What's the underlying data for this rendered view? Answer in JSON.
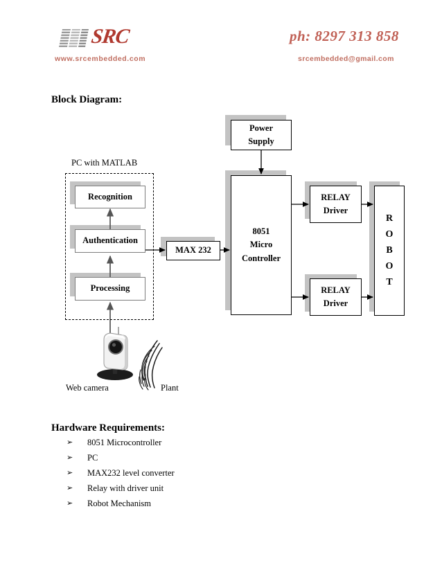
{
  "header": {
    "logo_text": "SRC",
    "phone": "ph: 8297 313 858",
    "website": "www.srcembedded.com",
    "email": "srcembedded@gmail.com",
    "accent_color": "#c06e60",
    "logo_color": "#b0392f"
  },
  "sections": {
    "block_diagram_heading": "Block Diagram:",
    "hardware_heading": "Hardware Requirements:"
  },
  "diagram": {
    "pc_label": "PC with MATLAB",
    "blocks": {
      "recognition": "Recognition",
      "authentication": "Authentication",
      "processing": "Processing",
      "max232": "MAX 232",
      "power_supply_line1": "Power",
      "power_supply_line2": "Supply",
      "mcu_line1": "8051",
      "mcu_line2": "Micro",
      "mcu_line3": "Controller",
      "relay_driver_top_line1": "RELAY",
      "relay_driver_top_line2": "Driver",
      "relay_driver_bottom_line1": "RELAY",
      "relay_driver_bottom_line2": "Driver",
      "robot_letters": [
        "R",
        "O",
        "B",
        "O",
        "T"
      ]
    },
    "image_labels": {
      "webcam": "Web camera",
      "plant": "Plant"
    },
    "colors": {
      "box_border": "#000000",
      "inner_box_border": "#7d7d7d",
      "shadow": "#c3c3c3",
      "arrow": "#000000"
    }
  },
  "hardware_requirements": {
    "bullet_glyph": "➢",
    "items": [
      "8051 Microcontroller",
      "PC",
      "MAX232 level converter",
      "Relay with driver unit",
      "Robot Mechanism"
    ]
  }
}
